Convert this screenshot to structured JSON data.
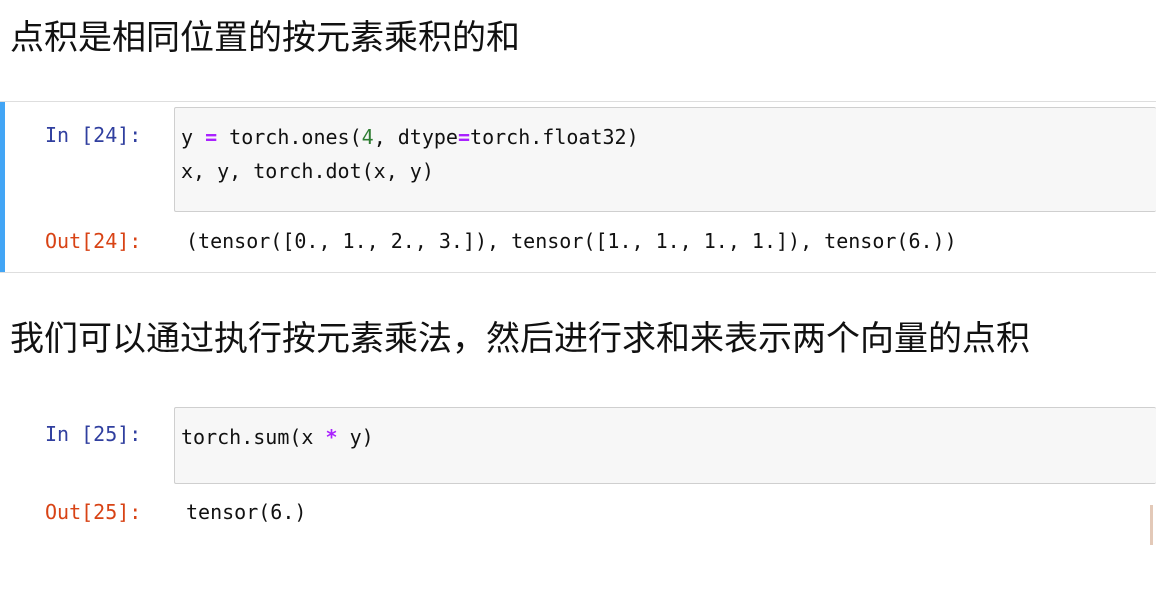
{
  "markdown": {
    "heading_1": "点积是相同位置的按元素乘积的和",
    "heading_2": "我们可以通过执行按元素乘法，然后进行求和来表示两个向量的点积"
  },
  "cells": [
    {
      "in_prompt": "In [24]:",
      "code": {
        "line1": {
          "a": "y ",
          "op1": "=",
          "b": " torch.ones(",
          "num": "4",
          "c": ", dtype",
          "op2": "=",
          "d": "torch.float32)"
        },
        "line2": "x, y, torch.dot(x, y)"
      },
      "out_prompt": "Out[24]:",
      "output": "(tensor([0., 1., 2., 3.]), tensor([1., 1., 1., 1.]), tensor(6.))"
    },
    {
      "in_prompt": "In [25]:",
      "code": {
        "line1": {
          "a": "torch.sum(x ",
          "op": "*",
          "b": " y)"
        }
      },
      "out_prompt": "Out[25]:",
      "output": "tensor(6.)"
    }
  ],
  "colors": {
    "in_prompt": "#303f9f",
    "out_prompt": "#d84315",
    "operator": "#aa22ff",
    "number": "#2e7d32",
    "selected_cell_bar": "#42a5f5"
  }
}
